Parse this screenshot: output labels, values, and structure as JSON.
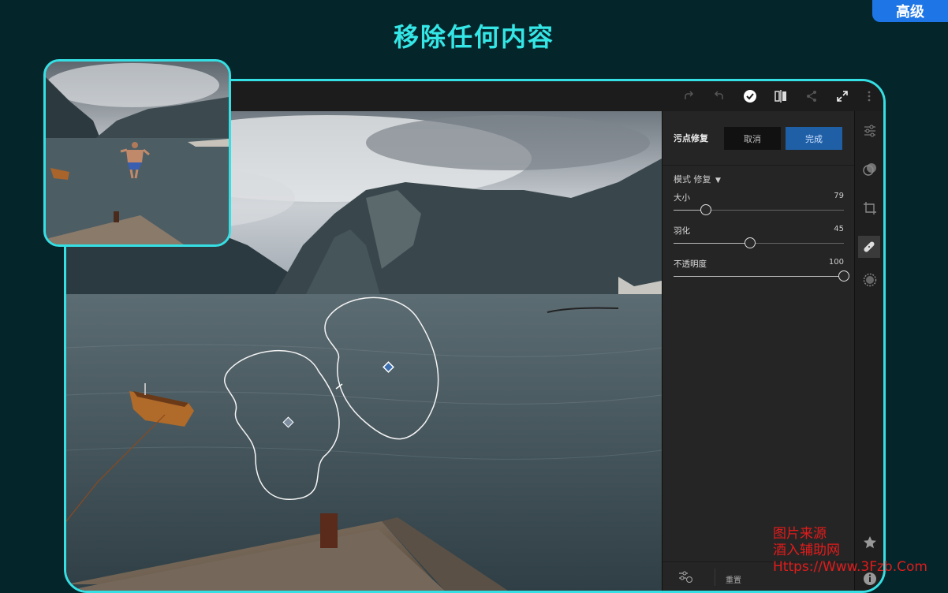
{
  "badge": "高级",
  "headline": "移除任何内容",
  "toolbar": {
    "icons": [
      "redo-icon",
      "undo-icon",
      "check-circle-icon",
      "compare-icon",
      "share-icon",
      "fullscreen-icon",
      "more-icon"
    ]
  },
  "panel": {
    "title": "污点修复",
    "cancel_label": "取消",
    "done_label": "完成",
    "mode_label": "模式 修复",
    "sliders": [
      {
        "label": "大小",
        "value": "79",
        "fraction": 0.19
      },
      {
        "label": "羽化",
        "value": "45",
        "fraction": 0.45
      },
      {
        "label": "不透明度",
        "value": "100",
        "fraction": 1.0
      }
    ],
    "reset_label": "重置"
  },
  "rail": {
    "icons": [
      "sliders-icon",
      "masking-icon",
      "crop-icon",
      "healing-brush-icon",
      "blur-icon",
      "star-icon",
      "info-icon"
    ]
  },
  "watermark": {
    "line1": "图片来源",
    "line2": "酒入辅助网",
    "line3": "Https://Www.3Fzb.Com"
  },
  "colors": {
    "background": "#04252a",
    "accent": "#35e0e4",
    "badge": "#1e76e6",
    "done_button": "#1e5fa6",
    "watermark": "#e21b1b"
  }
}
